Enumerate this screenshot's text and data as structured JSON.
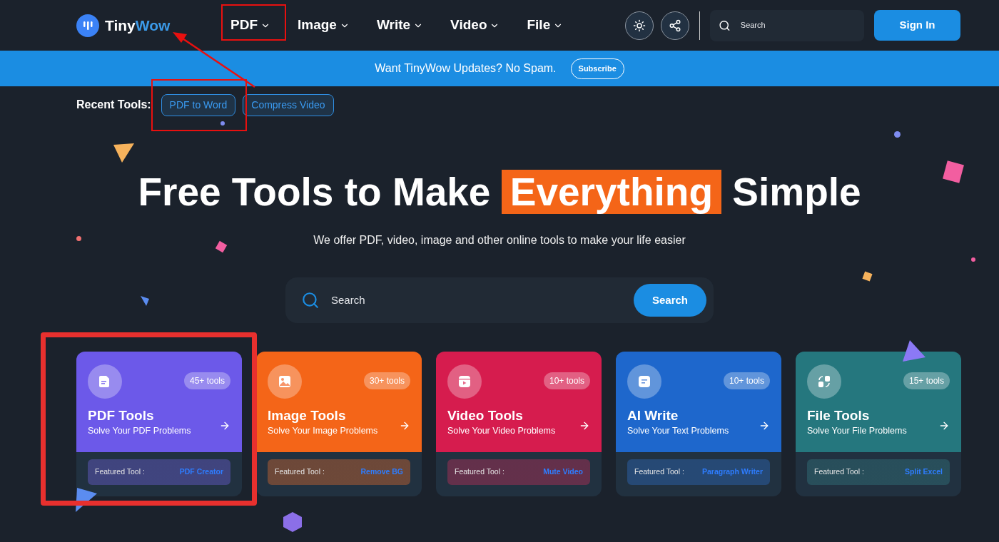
{
  "logo": {
    "first": "Tiny",
    "second": "Wow"
  },
  "nav": [
    {
      "label": "PDF"
    },
    {
      "label": "Image"
    },
    {
      "label": "Write"
    },
    {
      "label": "Video"
    },
    {
      "label": "File"
    }
  ],
  "header_search": {
    "placeholder": "Search"
  },
  "sign_in": "Sign In",
  "banner": {
    "text": "Want TinyWow Updates? No Spam.",
    "button": "Subscribe"
  },
  "recent_tools": {
    "label": "Recent Tools:",
    "items": [
      "PDF to Word",
      "Compress Video"
    ]
  },
  "hero": {
    "before": "Free Tools to Make ",
    "highlight": "Everything",
    "after": " Simple",
    "subtitle": "We offer PDF, video, image and other online tools to make your life easier"
  },
  "search": {
    "placeholder": "Search",
    "button": "Search"
  },
  "cards": [
    {
      "kind": "pdf",
      "title": "PDF Tools",
      "subtitle": "Solve Your PDF Problems",
      "count": "45+ tools",
      "featured_label": "Featured Tool :",
      "featured": "PDF Creator",
      "color": "#6c59e9"
    },
    {
      "kind": "image",
      "title": "Image Tools",
      "subtitle": "Solve Your Image Problems",
      "count": "30+ tools",
      "featured_label": "Featured Tool :",
      "featured": "Remove BG",
      "color": "#f46518"
    },
    {
      "kind": "video",
      "title": "Video Tools",
      "subtitle": "Solve Your Video Problems",
      "count": "10+ tools",
      "featured_label": "Featured Tool :",
      "featured": "Mute Video",
      "color": "#d61c4e"
    },
    {
      "kind": "write",
      "title": "AI Write",
      "subtitle": "Solve Your Text Problems",
      "count": "10+ tools",
      "featured_label": "Featured Tool :",
      "featured": "Paragraph Writer",
      "color": "#1e67cc"
    },
    {
      "kind": "file",
      "title": "File Tools",
      "subtitle": "Solve Your File Problems",
      "count": "15+ tools",
      "featured_label": "Featured Tool :",
      "featured": "Split Excel",
      "color": "#25777e"
    }
  ]
}
